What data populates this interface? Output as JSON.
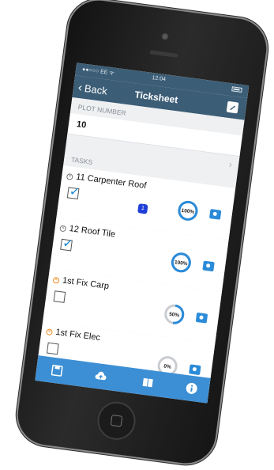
{
  "status_bar": {
    "carrier": "●●○○○ EE ᯤ",
    "time": "12:04"
  },
  "nav": {
    "back_label": "Back",
    "title": "Ticksheet",
    "edit_icon": "compose-icon"
  },
  "plot_section": {
    "header": "PLOT NUMBER",
    "value": "10"
  },
  "tasks_section": {
    "header": "TASKS"
  },
  "tasks": [
    {
      "name": "11 Carpenter Roof",
      "checked": true,
      "badge": "1",
      "progress_label": "100%",
      "progress": 1.0,
      "status": "grey"
    },
    {
      "name": "12 Roof Tile",
      "checked": true,
      "badge": "",
      "progress_label": "100%",
      "progress": 1.0,
      "status": "grey"
    },
    {
      "name": "1st Fix Carp",
      "checked": false,
      "badge": "",
      "progress_label": "50%",
      "progress": 0.5,
      "status": "orange"
    },
    {
      "name": "1st Fix Elec",
      "checked": false,
      "badge": "",
      "progress_label": "0%",
      "progress": 0.0,
      "status": "orange"
    }
  ],
  "tab_bar": {
    "icons": [
      "save-icon",
      "cloud-upload-icon",
      "book-icon",
      "info-icon"
    ]
  },
  "colors": {
    "nav_bar": "#3c5d76",
    "accent": "#2b8bd8",
    "tab_bar": "#3c8fd4",
    "badge": "#1f3fd8",
    "warning": "#f08a24"
  }
}
